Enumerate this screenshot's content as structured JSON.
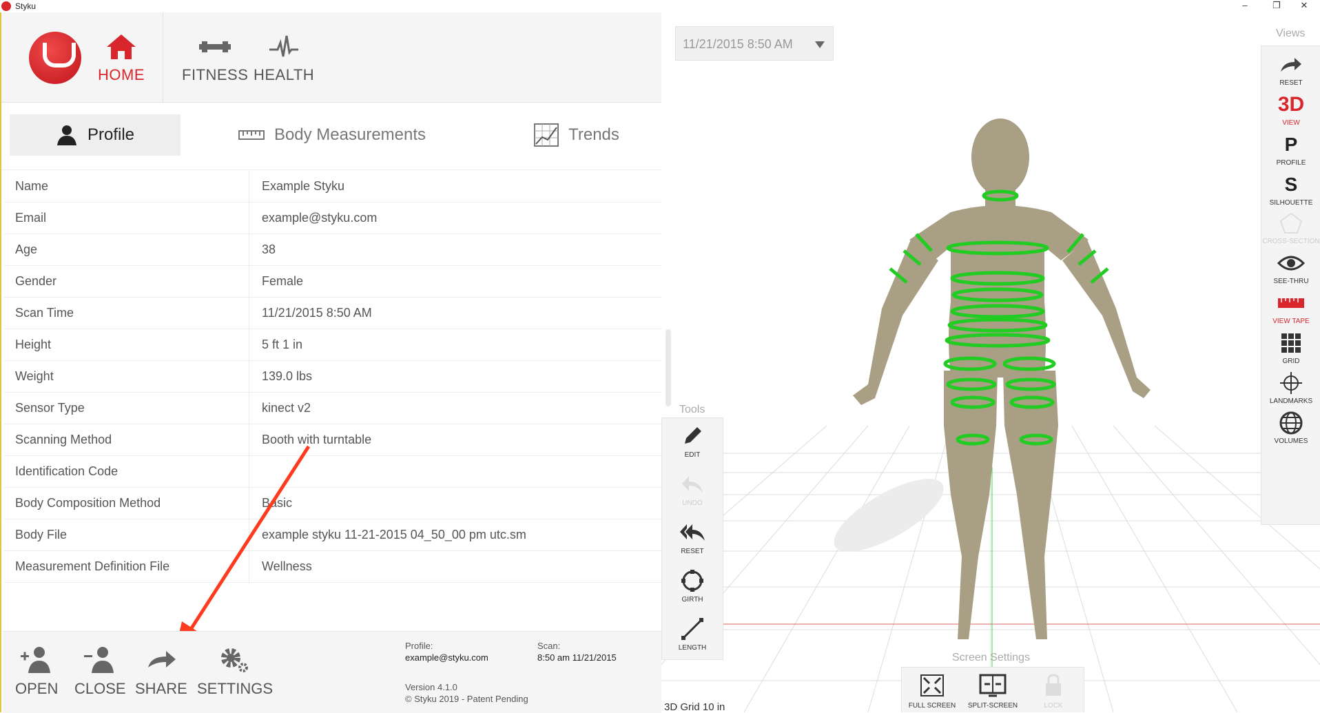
{
  "window": {
    "title": "Styku",
    "controls": [
      "–",
      "❐",
      "✕"
    ]
  },
  "nav": {
    "home": "HOME",
    "fitness": "FITNESS",
    "health": "HEALTH"
  },
  "tabs": {
    "profile": "Profile",
    "body_measurements": "Body Measurements",
    "trends": "Trends"
  },
  "profile_rows": [
    {
      "key": "Name",
      "value": "Example Styku"
    },
    {
      "key": "Email",
      "value": "example@styku.com"
    },
    {
      "key": "Age",
      "value": "38"
    },
    {
      "key": "Gender",
      "value": "Female"
    },
    {
      "key": "Scan Time",
      "value": "11/21/2015 8:50 AM"
    },
    {
      "key": "Height",
      "value": "5 ft 1 in"
    },
    {
      "key": "Weight",
      "value": "139.0 lbs"
    },
    {
      "key": "Sensor Type",
      "value": "kinect v2"
    },
    {
      "key": "Scanning Method",
      "value": "Booth with turntable"
    },
    {
      "key": "Identification Code",
      "value": ""
    },
    {
      "key": "Body Composition Method",
      "value": "Basic"
    },
    {
      "key": "Body File",
      "value": "example styku 11-21-2015 04_50_00 pm utc.sm"
    },
    {
      "key": "Measurement Definition File",
      "value": "Wellness"
    }
  ],
  "bottom": {
    "open": "OPEN",
    "close": "CLOSE",
    "share": "SHARE",
    "settings": "SETTINGS",
    "profile_label": "Profile:",
    "profile_value": "example@styku.com",
    "scan_label": "Scan:",
    "scan_value": "8:50 am 11/21/2015",
    "version": "Version 4.1.0",
    "copyright": "© Styku 2019 - Patent Pending"
  },
  "viewer": {
    "date_select": "11/21/2015 8:50 AM",
    "views_label": "Views",
    "views": {
      "reset": "RESET",
      "view3d_glyph": "3D",
      "view": "VIEW",
      "profile_glyph": "P",
      "profile": "PROFILE",
      "silhouette_glyph": "S",
      "silhouette": "SILHOUETTE",
      "cross_section": "CROSS-SECTION",
      "see_thru": "SEE-THRU",
      "view_tape": "VIEW TAPE",
      "grid": "GRID",
      "landmarks": "LANDMARKS",
      "volumes": "VOLUMES"
    },
    "tools_label": "Tools",
    "tools": {
      "edit": "EDIT",
      "undo": "UNDO",
      "reset": "RESET",
      "girth": "GIRTH",
      "length": "LENGTH"
    },
    "screen_settings_label": "Screen Settings",
    "screen": {
      "full_screen": "FULL SCREEN",
      "split_screen": "SPLIT-SCREEN",
      "lock": "LOCK"
    },
    "grid_label": "3D Grid 10 in"
  },
  "colors": {
    "accent": "#d8262c",
    "measure_rings": "#22cc22",
    "body": "#a89f84"
  }
}
